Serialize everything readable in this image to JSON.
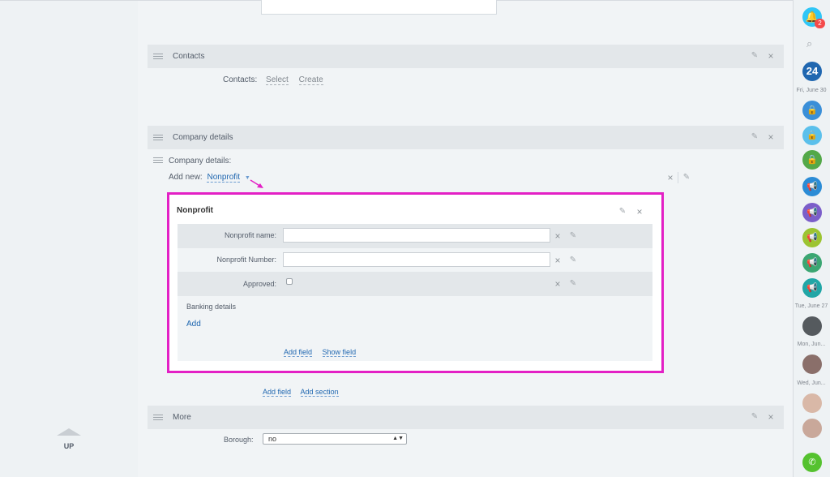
{
  "sections": {
    "contacts": {
      "title": "Contacts",
      "label": "Contacts:",
      "select_link": "Select",
      "create_link": "Create"
    },
    "company": {
      "title": "Company details",
      "label": "Company details:",
      "add_new_label": "Add new:",
      "add_new_value": "Nonprofit"
    },
    "more": {
      "title": "More",
      "borough_label": "Borough:",
      "borough_value": "no"
    }
  },
  "nonprofit": {
    "title": "Nonprofit",
    "fields": [
      {
        "label": "Nonprofit name:"
      },
      {
        "label": "Nonprofit Number:"
      },
      {
        "label": "Approved:"
      }
    ],
    "banking_label": "Banking details",
    "add_link": "Add",
    "add_field": "Add field",
    "show_field": "Show field"
  },
  "footer_links": {
    "add_field": "Add field",
    "add_section": "Add section"
  },
  "up_label": "UP",
  "right_panel": {
    "notification_count": "2",
    "calendar_day": "24",
    "dates": [
      "Fri, June 30",
      "Tue, June 27",
      "Mon, Jun...",
      "Wed, Jun..."
    ]
  },
  "colors": {
    "highlight_border": "#e320c5",
    "accent_blue": "#2067b0"
  }
}
